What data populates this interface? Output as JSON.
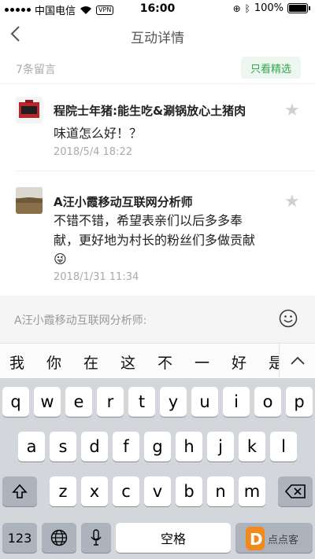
{
  "status_bar": {
    "carrier": "中国电信",
    "vpn": "VPN",
    "time": "16:00",
    "battery": "100%"
  },
  "nav": {
    "title": "互动详情"
  },
  "list_header": {
    "count": "7条留言",
    "filter": "只看精选"
  },
  "comments": [
    {
      "name": "程院士年猪:能生吃&涮锅放心土猪肉",
      "text": "味道怎么好！？",
      "time": "2018/5/4 18:22"
    },
    {
      "name": "A汪小霞移动互联网分析师",
      "text_line1": "不错不错，希望表亲们以后多多奉",
      "text_line2": "献，更好地为村长的粉丝们多做贡献",
      "emoji": "😜",
      "time": "2018/1/31 11:34"
    }
  ],
  "input": {
    "placeholder": "A汪小霞移动互联网分析师:"
  },
  "candidates": [
    "我",
    "你",
    "在",
    "这",
    "不",
    "一",
    "好",
    "是"
  ],
  "keyboard": {
    "row1": [
      "q",
      "w",
      "e",
      "r",
      "t",
      "y",
      "u",
      "i",
      "o",
      "p"
    ],
    "row2": [
      "a",
      "s",
      "d",
      "f",
      "g",
      "h",
      "j",
      "k",
      "l"
    ],
    "row3": [
      "z",
      "x",
      "c",
      "v",
      "b",
      "n",
      "m"
    ],
    "numbers": "123",
    "space": "空格",
    "shift_icon": "shift-icon",
    "delete_icon": "delete-icon",
    "globe_icon": "globe-icon",
    "mic_icon": "microphone-icon"
  },
  "watermark": "点点客",
  "colors": {
    "accent_green": "#2fa84f",
    "filter_bg": "#eef7ef"
  }
}
